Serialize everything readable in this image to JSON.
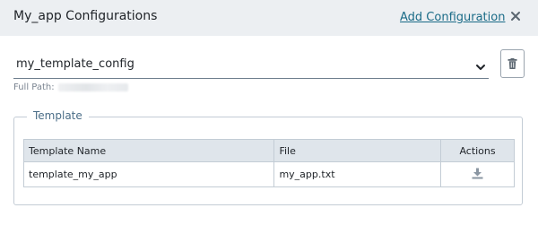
{
  "header": {
    "title": "My_app Configurations",
    "add_configuration_label": "Add Configuration",
    "close_icon": "close-icon"
  },
  "config_select": {
    "selected_value": "my_template_config",
    "icon": "chevron-down-icon"
  },
  "delete_button": {
    "icon": "trash-icon"
  },
  "full_path": {
    "label": "Full Path:",
    "value_redacted": true
  },
  "template_section": {
    "legend": "Template",
    "columns": [
      "Template Name",
      "File",
      "Actions"
    ],
    "rows": [
      {
        "template_name": "template_my_app",
        "file": "my_app.txt",
        "action_icon": "download-icon"
      }
    ]
  },
  "colors": {
    "header_bg": "#eceff2",
    "link": "#1a6b87",
    "legend_text": "#4a6d87",
    "table_header_bg": "#dfe5eb",
    "border": "#c3ccd5",
    "icon_gray": "#8a96a2"
  }
}
